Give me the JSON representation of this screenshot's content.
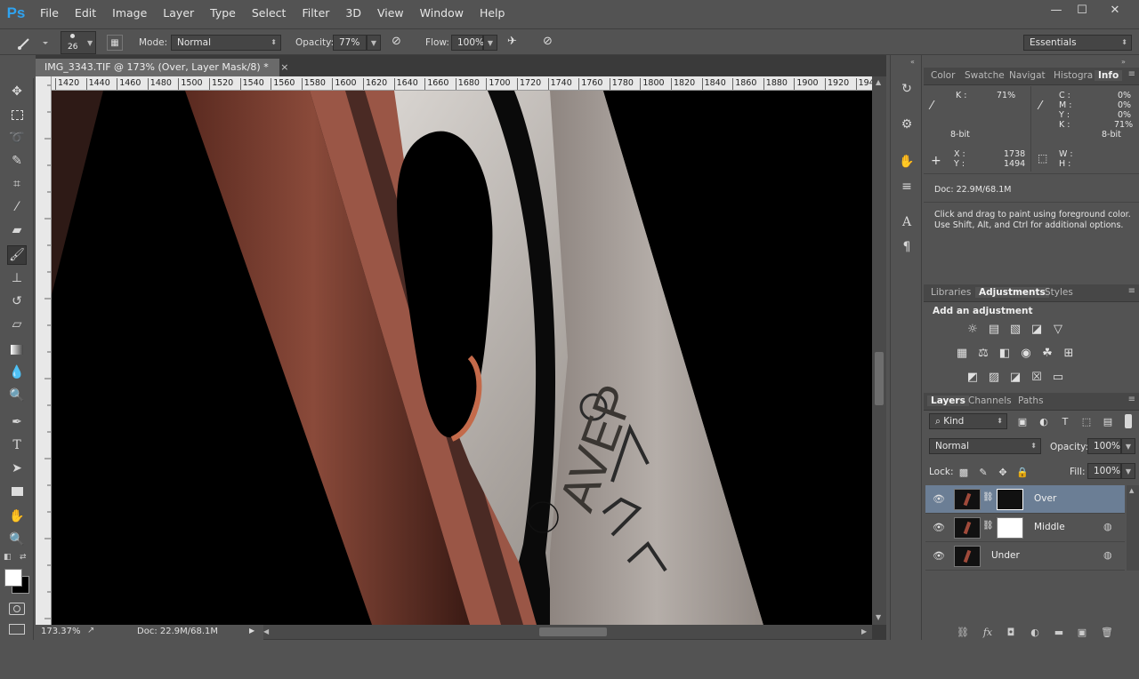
{
  "app": {
    "logo": "Ps"
  },
  "menu": [
    "File",
    "Edit",
    "Image",
    "Layer",
    "Type",
    "Select",
    "Filter",
    "3D",
    "View",
    "Window",
    "Help"
  ],
  "window_controls": {
    "minimize": "—",
    "maximize": "☐",
    "close": "✕"
  },
  "options": {
    "brush_size": "26",
    "mode_label": "Mode:",
    "mode_value": "Normal",
    "opacity_label": "Opacity:",
    "opacity_value": "77%",
    "flow_label": "Flow:",
    "flow_value": "100%",
    "workspace": "Essentials"
  },
  "document": {
    "tab_title": "IMG_3343.TIF @ 173% (Over, Layer Mask/8) *",
    "close": "×",
    "ruler_ticks": [
      "1420",
      "1440",
      "1460",
      "1480",
      "1500",
      "1520",
      "1540",
      "1560",
      "1580",
      "1600",
      "1620",
      "1640",
      "1660",
      "1680",
      "1700",
      "1720",
      "1740",
      "1760",
      "1780",
      "1800",
      "1820",
      "1840",
      "1860",
      "1880",
      "1900",
      "1920",
      "194"
    ],
    "zoom": "173.37%",
    "doc_size": "Doc: 22.9M/68.1M",
    "engraving": "AVEP"
  },
  "info_panel": {
    "tabs": [
      "Color",
      "Swatche",
      "Navigat",
      "Histogra",
      "Info"
    ],
    "active_tab": "Info",
    "k_left_label": "K :",
    "k_left_value": "71%",
    "bit_left": "8-bit",
    "c_label": "C :",
    "c_value": "0%",
    "m_label": "M :",
    "m_value": "0%",
    "y_label": "Y :",
    "y_value": "0%",
    "k_right_label": "K :",
    "k_right_value": "71%",
    "bit_right": "8-bit",
    "x_label": "X :",
    "x_value": "1738",
    "y_coord_label": "Y :",
    "y_coord_value": "1494",
    "w_label": "W :",
    "h_label": "H :",
    "doc": "Doc: 22.9M/68.1M",
    "hint_line1": "Click and drag to paint using foreground color.",
    "hint_line2": "Use Shift, Alt, and Ctrl for additional options."
  },
  "adjustments_panel": {
    "tabs": [
      "Libraries",
      "Adjustments",
      "Styles"
    ],
    "active_tab": "Adjustments",
    "heading": "Add an adjustment"
  },
  "layers_panel": {
    "tabs": [
      "Layers",
      "Channels",
      "Paths"
    ],
    "active_tab": "Layers",
    "filter_kind": "Kind",
    "blend_mode": "Normal",
    "opacity_label": "Opacity:",
    "opacity_value": "100%",
    "lock_label": "Lock:",
    "fill_label": "Fill:",
    "fill_value": "100%",
    "layers": [
      {
        "name": "Over",
        "selected": true
      },
      {
        "name": "Middle",
        "selected": false
      },
      {
        "name": "Under",
        "selected": false
      }
    ]
  },
  "colors": {
    "accent": "#2fa3f0",
    "selection": "#6b7e95",
    "panel_bg": "#535353"
  }
}
